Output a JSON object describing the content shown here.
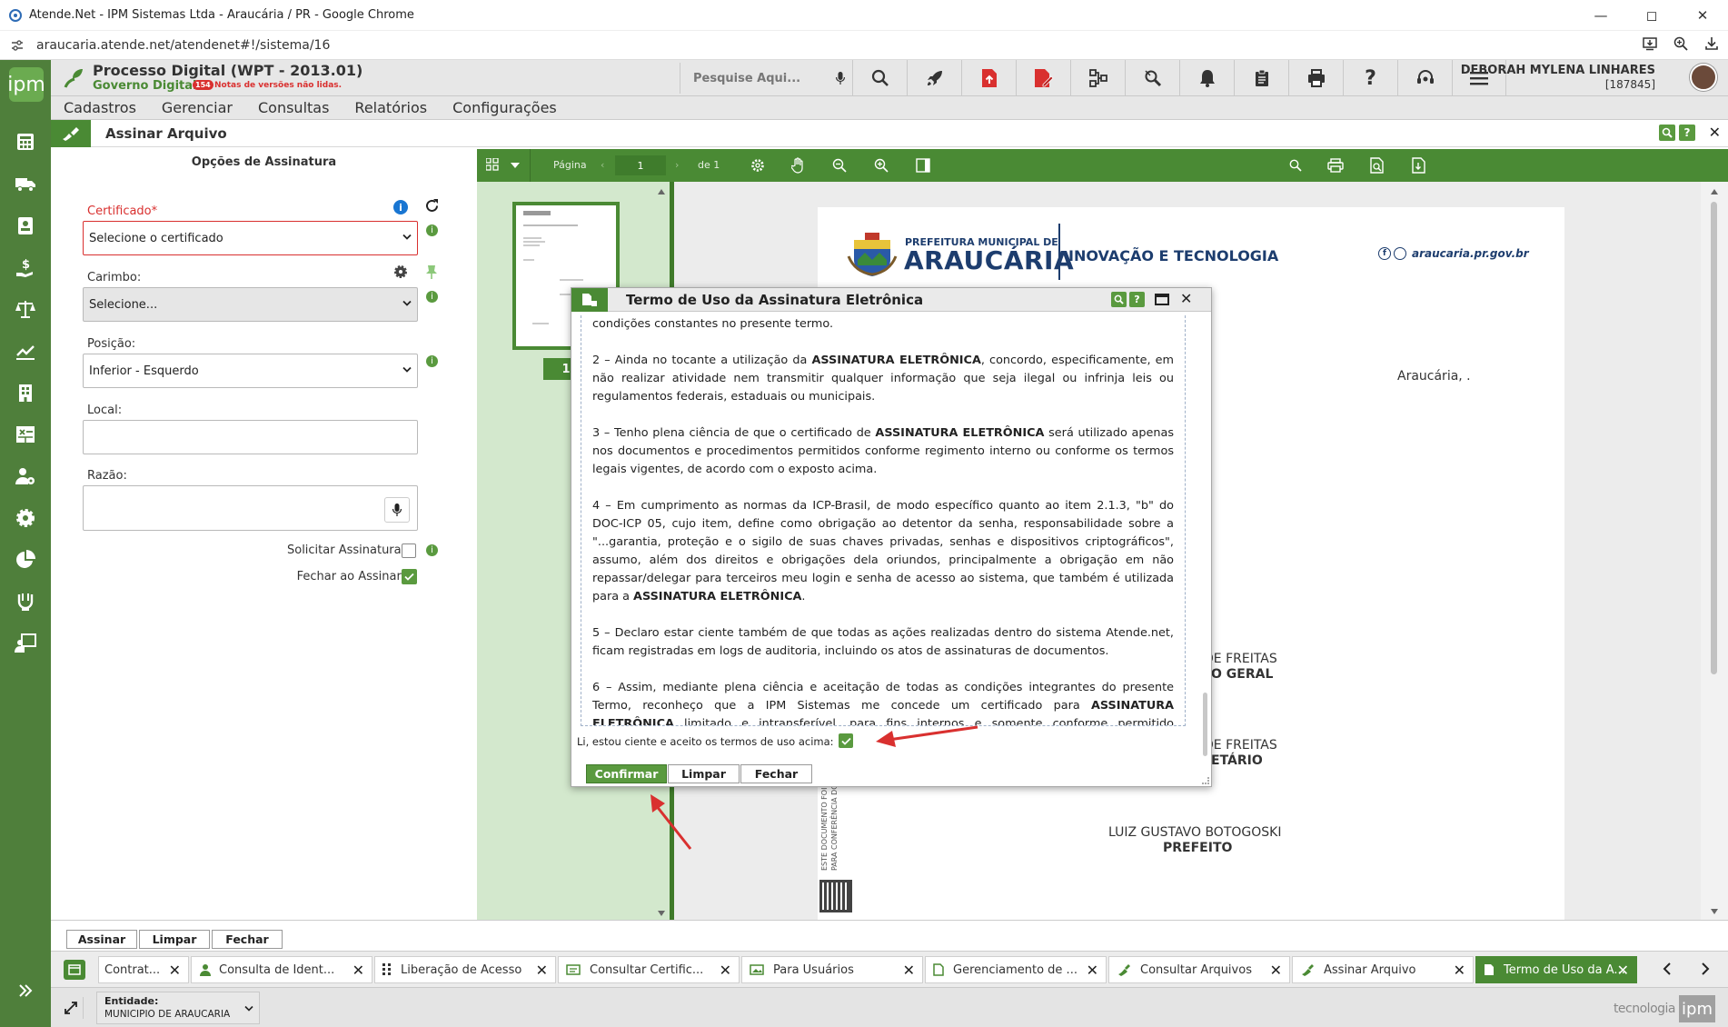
{
  "browser": {
    "title": "Atende.Net - IPM Sistemas Ltda - Araucária / PR - Google Chrome",
    "url": "araucaria.atende.net/atendenet#!/sistema/16"
  },
  "app": {
    "logo": "ipm",
    "system_name": "Processo Digital (WPT - 2013.01)",
    "subtitle": "Governo Digital",
    "notes_badge": "154",
    "notes_text": "Notas de versões não lidas.",
    "search_placeholder": "Pesquise Aqui...",
    "user_name": "DEBORAH MYLENA LINHARES",
    "user_id": "[187845]",
    "menu": [
      "Cadastros",
      "Gerenciar",
      "Consultas",
      "Relatórios",
      "Configurações"
    ],
    "page_title": "Assinar Arquivo"
  },
  "form": {
    "heading": "Opções de Assinatura",
    "certificado_label": "Certificado*",
    "certificado_value": "Selecione o certificado",
    "carimbo_label": "Carimbo:",
    "carimbo_value": "Selecione...",
    "posicao_label": "Posição:",
    "posicao_value": "Inferior - Esquerdo",
    "local_label": "Local:",
    "razao_label": "Razão:",
    "solicitar_label": "Solicitar Assinatura:",
    "fechar_label": "Fechar ao Assinar:"
  },
  "viewer": {
    "page_label": "Página",
    "page_value": "1",
    "page_total": "de 1",
    "thumb_page": "1"
  },
  "document": {
    "header_small": "PREFEITURA MUNICIPAL DE",
    "header_big": "ARAUCÁRIA",
    "header_dept": "INOVAÇÃO E TECNOLOGIA",
    "site": "araucaria.pr.gov.br",
    "city_date": "Araucária, .",
    "sig1_name": "DE FREITAS",
    "sig1_role": "O GERAL",
    "sig2_name": "DE FREITAS",
    "sig2_role": "ETÁRIO",
    "sig3_name": "LUIZ GUSTAVO BOTOGOSKI",
    "sig3_role": "PREFEITO",
    "side_text1": "ESTE DOCUMENTO FOI A",
    "side_text2": "PARA CONFERÊNCIA DO"
  },
  "modal": {
    "title": "Termo de Uso da Assinatura Eletrônica",
    "p0": "condições constantes no presente termo.",
    "p2a": "2 – Ainda no tocante a utilização da ",
    "p2b": "ASSINATURA ELETRÔNICA",
    "p2c": ", concordo, especificamente, em não realizar atividade nem transmitir qualquer informação que seja ilegal ou infrinja leis ou regulamentos federais, estaduais ou municipais.",
    "p3a": "3 – Tenho plena ciência de que o certificado de ",
    "p3b": "ASSINATURA ELETRÔNICA",
    "p3c": " será utilizado apenas nos documentos e procedimentos permitidos conforme regimento interno ou conforme os termos legais vigentes, de acordo com o exposto acima.",
    "p4a": "4 – Em cumprimento as normas da ICP-Brasil, de modo específico quanto ao item 2.1.3, \"b\" do DOC-ICP 05, cujo item, define como obrigação ao detentor da senha, responsabilidade sobre a \"...garantia, proteção e o sigilo de suas chaves privadas, senhas e dispositivos criptográficos\", assumo, além dos direitos e obrigações dela oriundos, principalmente a obrigação em não repassar/delegar para terceiros meu login e senha de acesso ao sistema, que também é utilizada para a ",
    "p4b": "ASSINATURA ELETRÔNICA",
    "p4c": ".",
    "p5": "5 – Declaro estar ciente também de que todas as ações realizadas dentro do sistema Atende.net, ficam registradas em logs de auditoria, incluindo os atos de assinaturas de documentos.",
    "p6a": "6 – Assim, mediante plena ciência e aceitação de todas as condições integrantes do presente Termo, reconheço que a IPM Sistemas me concede um certificado para ",
    "p6b": "ASSINATURA ELETRÔNICA",
    "p6c": " limitado e intransferível, para fins internos e somente conforme permitido expressamente no presente Termo.",
    "accept_label": "Li, estou ciente e aceito os termos de uso acima:",
    "btn_confirm": "Confirmar",
    "btn_clear": "Limpar",
    "btn_close": "Fechar"
  },
  "bottom": {
    "btn_sign": "Assinar",
    "btn_clear": "Limpar",
    "btn_close": "Fechar"
  },
  "tabs": [
    "Contrat...",
    "Consulta de Ident...",
    "Liberação de Acesso",
    "Consultar Certific...",
    "Para Usuários",
    "Gerenciamento de ...",
    "Consultar Arquivos",
    "Assinar Arquivo",
    "Termo de Uso da A..."
  ],
  "status": {
    "entity_label": "Entidade:",
    "entity_value": "MUNICIPIO DE ARAUCARIA",
    "brand": "tecnologia",
    "brand_logo": "ipm"
  },
  "colors": {
    "brand_green": "#4a8a34",
    "rail_green": "#4f7f3b",
    "required_red": "#d9302f",
    "info_blue": "#1976d2"
  }
}
